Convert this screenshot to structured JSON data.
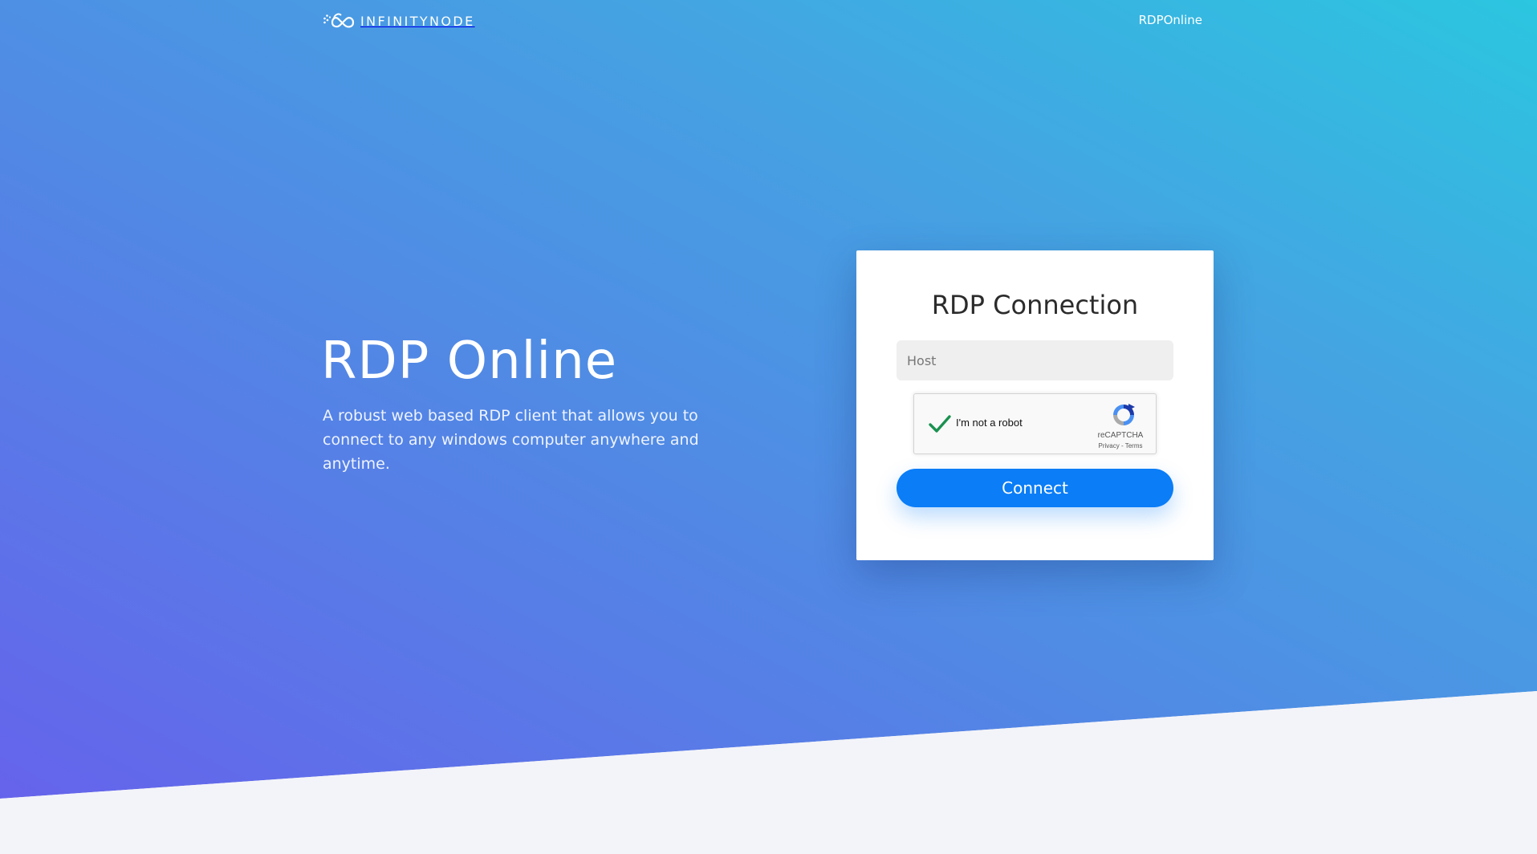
{
  "nav": {
    "brand_text": "INFINITYNODE",
    "link_label": "RDPOnline"
  },
  "hero": {
    "title": "RDP Online",
    "subtitle": "A robust web based RDP client that allows you to connect to any windows computer anywhere and anytime."
  },
  "form": {
    "title": "RDP Connection",
    "host_placeholder": "Host",
    "host_value": "",
    "connect_label": "Connect",
    "recaptcha": {
      "label": "I'm not a robot",
      "brand": "reCAPTCHA",
      "privacy": "Privacy",
      "separator": " - ",
      "terms": "Terms",
      "checked": true
    }
  },
  "colors": {
    "gradient_start": "#6760ec",
    "gradient_end": "#2bc6e0",
    "button": "#0a7df7",
    "check": "#1a9150",
    "bottom_band": "#f3f4f9"
  },
  "icons": [
    "infinity-cloud-logo-icon",
    "checkmark-icon",
    "recaptcha-logo-icon"
  ]
}
